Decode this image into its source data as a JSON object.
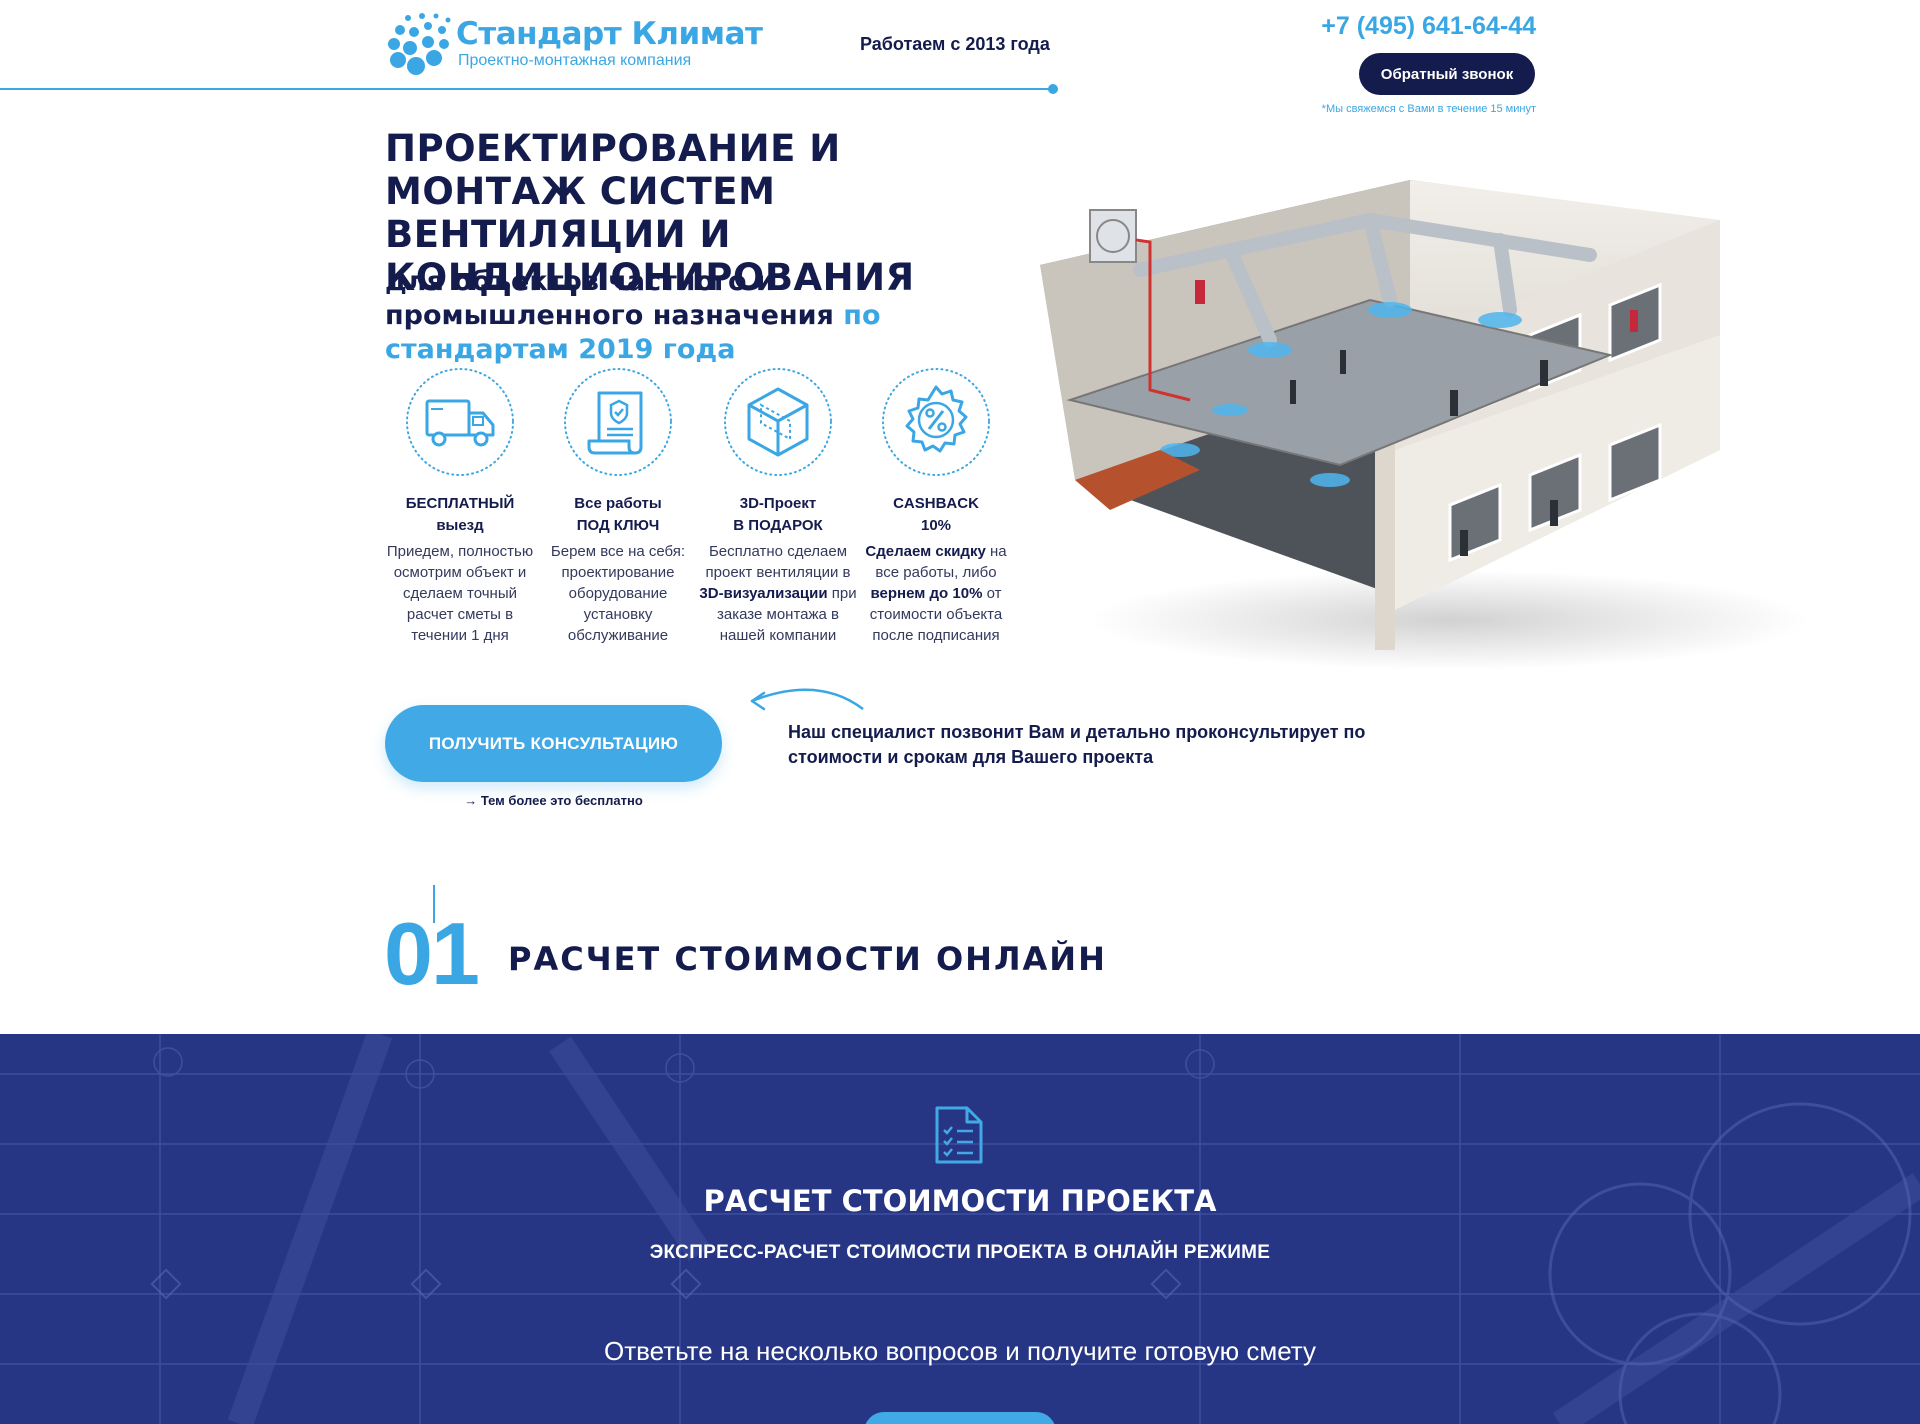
{
  "header": {
    "logo_title": "Стандарт Климат",
    "logo_subtitle": "Проектно-монтажная компания",
    "since": "Работаем с 2013 года",
    "phone": "+7 (495) 641-64-44",
    "callback_button": "Обратный звонок",
    "callback_note": "*Мы свяжемся с Вами в течение 15 минут"
  },
  "hero": {
    "title": "ПРОЕКТИРОВАНИЕ И МОНТАЖ СИСТЕМ ВЕНТИЛЯЦИИ И КОНДИЦИОНИРОВАНИЯ",
    "subtitle_main": "для объектов частного и промышленного назначения",
    "subtitle_accent": "по стандартам 2019 года"
  },
  "features": [
    {
      "icon": "truck-icon",
      "title": "БЕСПЛАТНЫЙ\nвыезд",
      "text": "Приедем, полностью осмотрим объект и сделаем точный расчет сметы в течении 1 дня"
    },
    {
      "icon": "contract-icon",
      "title": "Все работы\nПОД КЛЮЧ",
      "text": "Берем все на себя: проектирование оборудование установку обслуживание"
    },
    {
      "icon": "cube-3d-icon",
      "title": "3D-Проект\nВ ПОДАРОК",
      "text_1": "Бесплатно сделаем проект вентиляции в",
      "text_bold": "3D-визуализации",
      "text_2": "при заказе монтажа в нашей компании"
    },
    {
      "icon": "percent-badge-icon",
      "title": "CASHBACK\n10%",
      "text_bold_1": "Сделаем скидку",
      "text_1": "на все работы, либо",
      "text_bold_2": "вернем до 10%",
      "text_2": "от стоимости объекта после подписания"
    }
  ],
  "cta": {
    "button": "ПОЛУЧИТЬ КОНСУЛЬТАЦИЮ",
    "note": "→ Тем более это бесплатно",
    "text": "Наш специалист позвонит Вам и детально проконсультирует по стоимости и срокам для Вашего проекта"
  },
  "section": {
    "number": "01",
    "title": "РАСЧЕТ СТОИМОСТИ ОНЛАЙН"
  },
  "band": {
    "icon": "checklist-document-icon",
    "title": "РАСЧЕТ СТОИМОСТИ ПРОЕКТА",
    "subtitle": "ЭКСПРЕСС-РАСЧЕТ СТОИМОСТИ ПРОЕКТА В ОНЛАЙН РЕЖИМЕ",
    "text": "Ответьте на несколько вопросов и получите готовую смету"
  },
  "colors": {
    "accent": "#3aa7e4",
    "navy": "#141b4d",
    "band": "#263685",
    "button": "#41aae6"
  }
}
